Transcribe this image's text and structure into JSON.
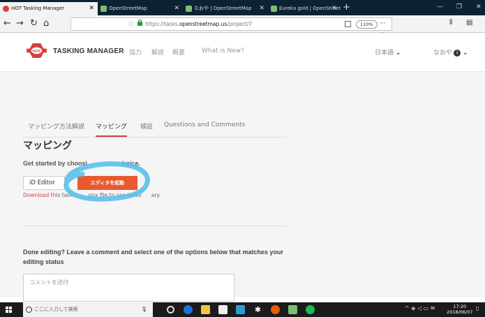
{
  "browser": {
    "tabs": [
      {
        "label": "HOT Tasking Manager",
        "active": true
      },
      {
        "label": "OpenStreetMap",
        "active": false
      },
      {
        "label": "なおや | OpenStreetMap",
        "active": false
      },
      {
        "label": "Eureka gold | OpenStreetMap",
        "active": false
      }
    ],
    "url_prefix": "https://tasks.",
    "url_domain": "openstreetmap.us",
    "url_path": "/project/7",
    "zoom": "110%"
  },
  "header": {
    "logo_text": "HOT",
    "brand": "TASKING MANAGER",
    "nav": [
      "協力",
      "解説",
      "概要",
      "What is New?"
    ],
    "language": "日本語",
    "user": "なおや",
    "notification_count": "1"
  },
  "main": {
    "tabs": [
      {
        "label": "マッピング方法解説",
        "active": false
      },
      {
        "label": "マッピング",
        "active": true
      },
      {
        "label": "検証",
        "active": false
      },
      {
        "label": "Questions and Comments",
        "active": false
      }
    ],
    "heading": "マッピング",
    "lead_start": "Get started by choosi",
    "lead_end": "hoice.",
    "editor_value": "iD Editor",
    "start_button": "エディタを起動",
    "download_link": "Download",
    "download_text_a": " this task",
    "download_text_b": "gpx file to see its bo",
    "download_text_c": "ary.",
    "done_text": "Done editing? Leave a comment and select one of the options below that matches your editing status",
    "comment_placeholder": "コメントを送付"
  },
  "taskbar": {
    "search_placeholder": "ここに入力して検索",
    "time": "17:20",
    "date": "2018/06/07"
  },
  "colors": {
    "accent": "#d73f3f",
    "button": "#e8592f",
    "annotation": "#5bc0eb"
  }
}
